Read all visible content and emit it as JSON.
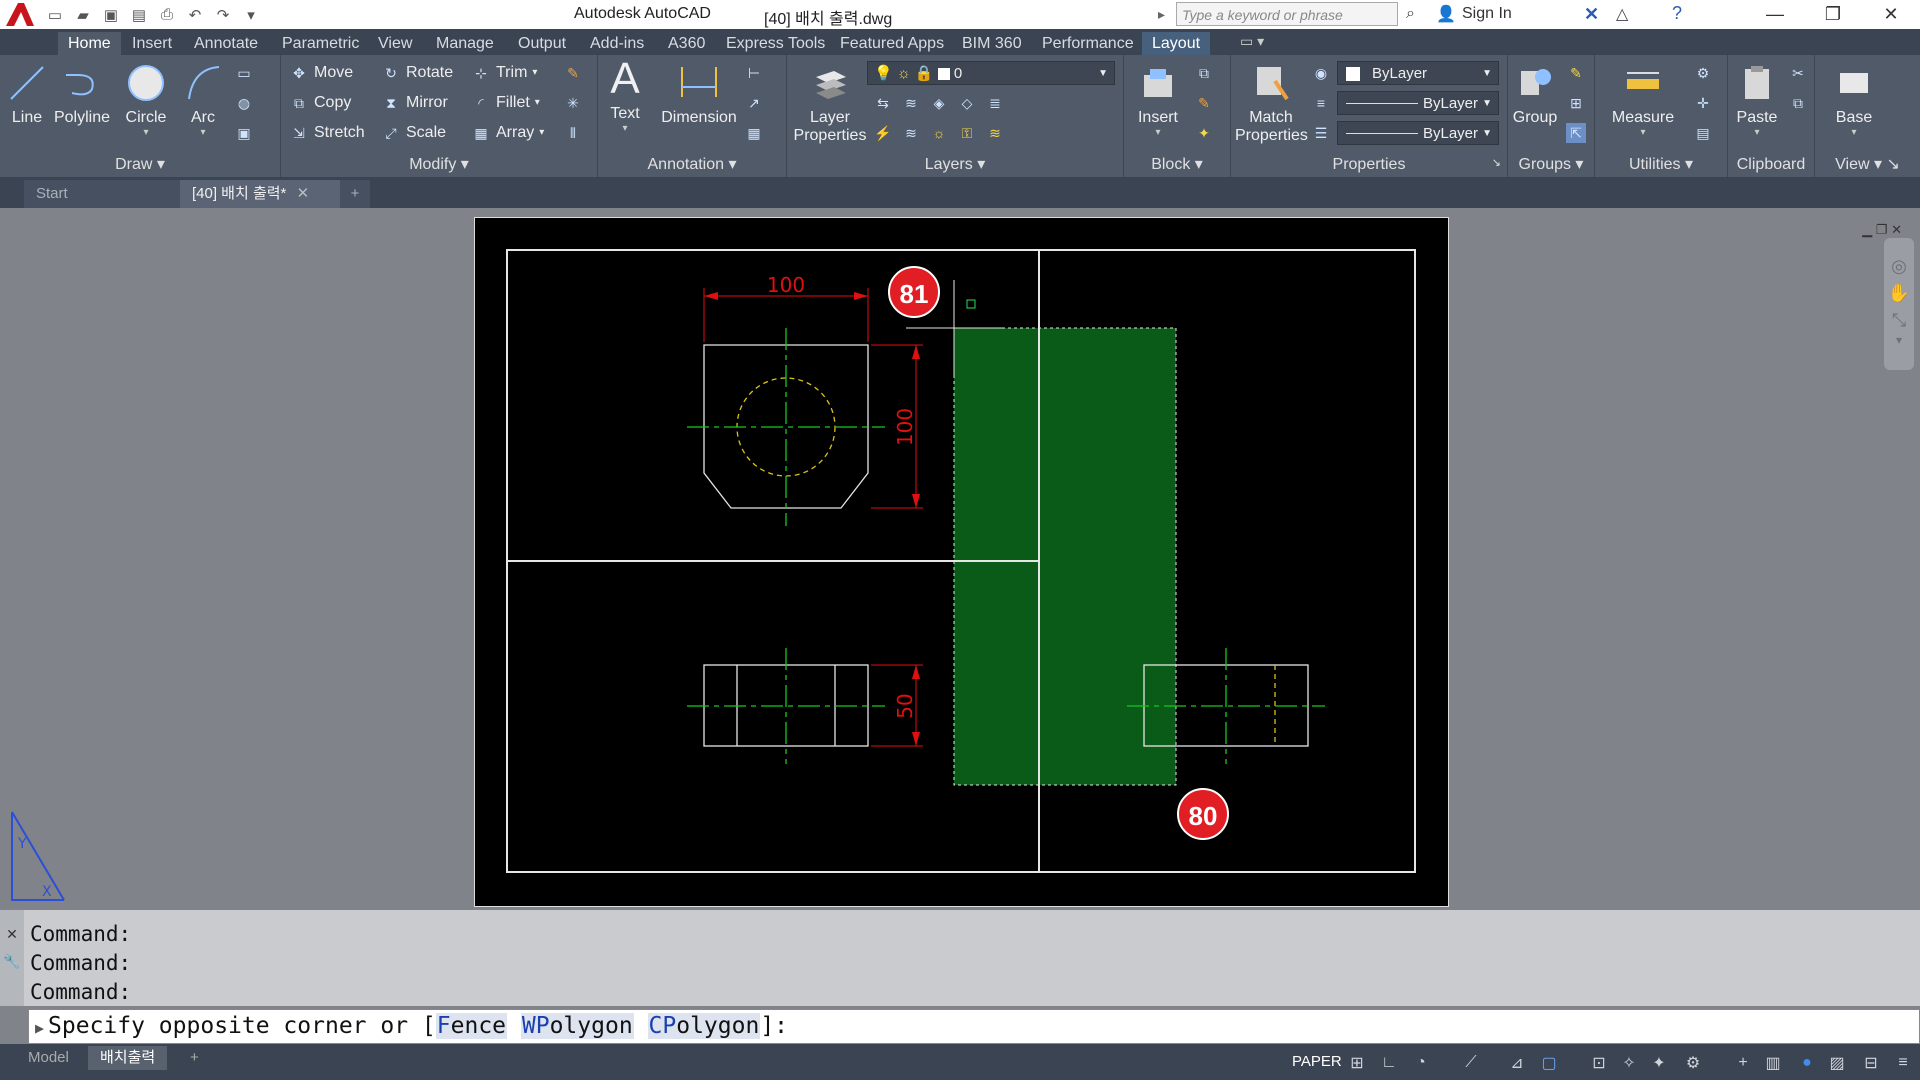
{
  "title_bar": {
    "app_name": "Autodesk AutoCAD",
    "file_name": "[40] 배치 출력.dwg",
    "search_placeholder": "Type a keyword or phrase",
    "sign_in": "Sign In"
  },
  "ribbon_tabs": [
    "Home",
    "Insert",
    "Annotate",
    "Parametric",
    "View",
    "Manage",
    "Output",
    "Add-ins",
    "A360",
    "Express Tools",
    "Featured Apps",
    "BIM 360",
    "Performance",
    "Layout"
  ],
  "ribbon": {
    "draw": {
      "title": "Draw",
      "line": "Line",
      "polyline": "Polyline",
      "circle": "Circle",
      "arc": "Arc"
    },
    "modify": {
      "title": "Modify",
      "move": "Move",
      "rotate": "Rotate",
      "trim": "Trim",
      "copy": "Copy",
      "mirror": "Mirror",
      "fillet": "Fillet",
      "stretch": "Stretch",
      "scale": "Scale",
      "array": "Array"
    },
    "annotation": {
      "title": "Annotation",
      "text": "Text",
      "dimension": "Dimension"
    },
    "layers": {
      "title": "Layers",
      "layer_properties": "Layer Properties",
      "current_layer": "0"
    },
    "block": {
      "title": "Block",
      "insert": "Insert"
    },
    "properties": {
      "title": "Properties",
      "match_properties": "Match Properties",
      "color": "ByLayer",
      "linetype": "ByLayer",
      "lineweight": "ByLayer"
    },
    "groups": {
      "title": "Groups",
      "group": "Group"
    },
    "utilities": {
      "title": "Utilities",
      "measure": "Measure"
    },
    "clipboard": {
      "title": "Clipboard",
      "paste": "Paste"
    },
    "view": {
      "title": "View",
      "base": "Base"
    }
  },
  "doc_tabs": {
    "start": "Start",
    "active": "[40] 배치 출력*"
  },
  "drawing": {
    "dim_top": "100",
    "dim_right": "100",
    "dim_bottom": "50"
  },
  "badges": {
    "first": "81",
    "second": "80"
  },
  "command": {
    "history": [
      "Command:",
      "Command:",
      "Command:"
    ],
    "prompt_start": "Specify opposite corner or [",
    "opt_fence_key": "F",
    "opt_fence_rest": "ence",
    "opt_wpoly_key": "WP",
    "opt_wpoly_rest": "olygon",
    "opt_cpoly_key": "CP",
    "opt_cpoly_rest": "olygon",
    "prompt_end": "]:"
  },
  "status": {
    "model_tab": "Model",
    "layout_tab": "배치출력",
    "paper": "PAPER"
  },
  "colors": {
    "selection_fill": "#0a5a18",
    "dim_red": "#e01010",
    "center_green": "#16c81e",
    "hidden_yellow": "#d9c31a",
    "badge_red": "#e11e24"
  }
}
